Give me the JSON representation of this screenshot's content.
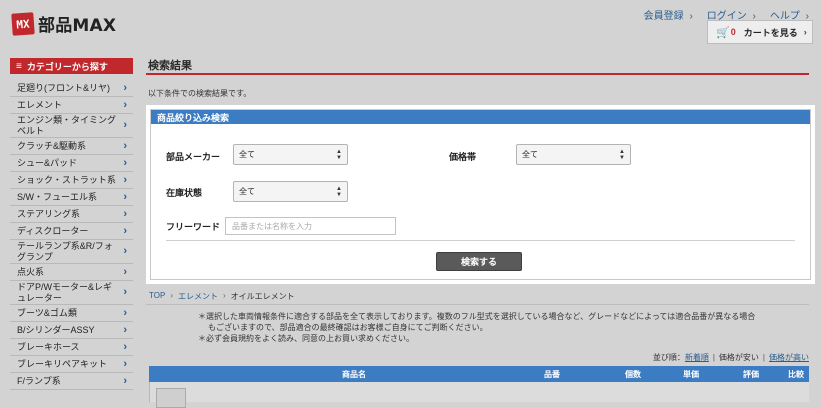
{
  "header": {
    "logo_badge": "MX",
    "logo_text": "部品MAX",
    "nav": [
      "会員登録",
      "ログイン",
      "ヘルプ"
    ],
    "cart": {
      "count": "0",
      "label": "カートを見る"
    }
  },
  "sidebar": {
    "heading": "カテゴリーから探す",
    "items": [
      "足廻り(フロント&リヤ)",
      "エレメント",
      "エンジン類・タイミングベルト",
      "クラッチ&駆動系",
      "シュー&パッド",
      "ショック・ストラット系",
      "S/W・フューエル系",
      "ステアリング系",
      "ディスクローター",
      "テールランプ系&R/フォグランプ",
      "点火系",
      "ドアP/Wモーター&レギュレーター",
      "ブーツ&ゴム類",
      "B/シリンダーASSY",
      "ブレーキホース",
      "ブレーキリペアキット",
      "F/ランプ系"
    ]
  },
  "main": {
    "title": "検索結果",
    "intro": "以下条件での検索結果です。",
    "filter": {
      "heading": "商品絞り込み検索",
      "maker_label": "部品メーカー",
      "maker_value": "全て",
      "price_label": "価格帯",
      "price_value": "全て",
      "stock_label": "在庫状態",
      "stock_value": "全て",
      "keyword_label": "フリーワード",
      "keyword_placeholder": "品番または名称を入力",
      "search_button": "検索する"
    },
    "breadcrumb": [
      "TOP",
      "エレメント",
      "オイルエレメント"
    ],
    "notes": [
      "＊選択した車両情報条件に適合する部品を全て表示しております。複数のフル型式を選択している場合など、グレードなどによっては適合品番が異なる場合もございますので、部品適合の最終確認はお客様ご自身にてご判断ください。",
      "＊必ず会員規約をよく読み、同意の上お買い求めください。"
    ],
    "sort": {
      "label": "並び順：",
      "options": [
        "新着順",
        "価格が安い",
        "価格が高い"
      ]
    },
    "table": {
      "columns": [
        "商品名",
        "品番",
        "個数",
        "単価",
        "評価",
        "比較"
      ]
    }
  }
}
